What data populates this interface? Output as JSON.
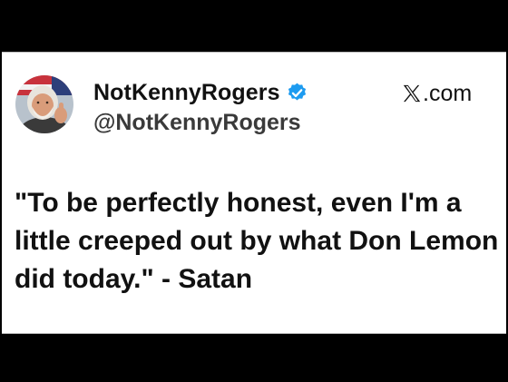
{
  "post": {
    "display_name": "NotKennyRogers",
    "handle": "@NotKennyRogers",
    "verified": true,
    "source_suffix": ".com",
    "text": "\"To be perfectly honest, even I'm a little creeped out by what Don Lemon did today.\" - Satan"
  },
  "icons": {
    "avatar": "avatar-photo",
    "verified": "verified-badge-icon",
    "source_logo": "x-logo-icon"
  },
  "colors": {
    "background": "#000000",
    "card": "#ffffff",
    "text": "#111111",
    "handle": "#3a3a3a",
    "verified_badge": "#1d9bf0"
  }
}
